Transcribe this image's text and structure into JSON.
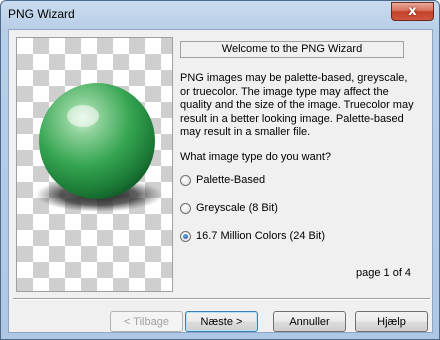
{
  "window": {
    "title": "PNG Wizard",
    "close_glyph": "x",
    "close_icon": "close-icon"
  },
  "wizard": {
    "heading": "Welcome to the PNG Wizard",
    "description": "PNG images may be palette-based, greyscale, or truecolor. The image type may affect the quality and the size of the image. Truecolor may result in a better looking image. Palette-based may result in a smaller file.",
    "question": "What image type do you want?",
    "options": [
      {
        "label": "Palette-Based",
        "checked": false
      },
      {
        "label": "Greyscale (8 Bit)",
        "checked": false
      },
      {
        "label": "16.7 Million Colors (24 Bit)",
        "checked": true
      }
    ],
    "page_indicator": "page 1 of 4",
    "preview_icon": "green-sphere-preview"
  },
  "buttons": {
    "back": "< Tilbage",
    "next": "Næste >",
    "cancel": "Annuller",
    "help": "Hjælp"
  }
}
